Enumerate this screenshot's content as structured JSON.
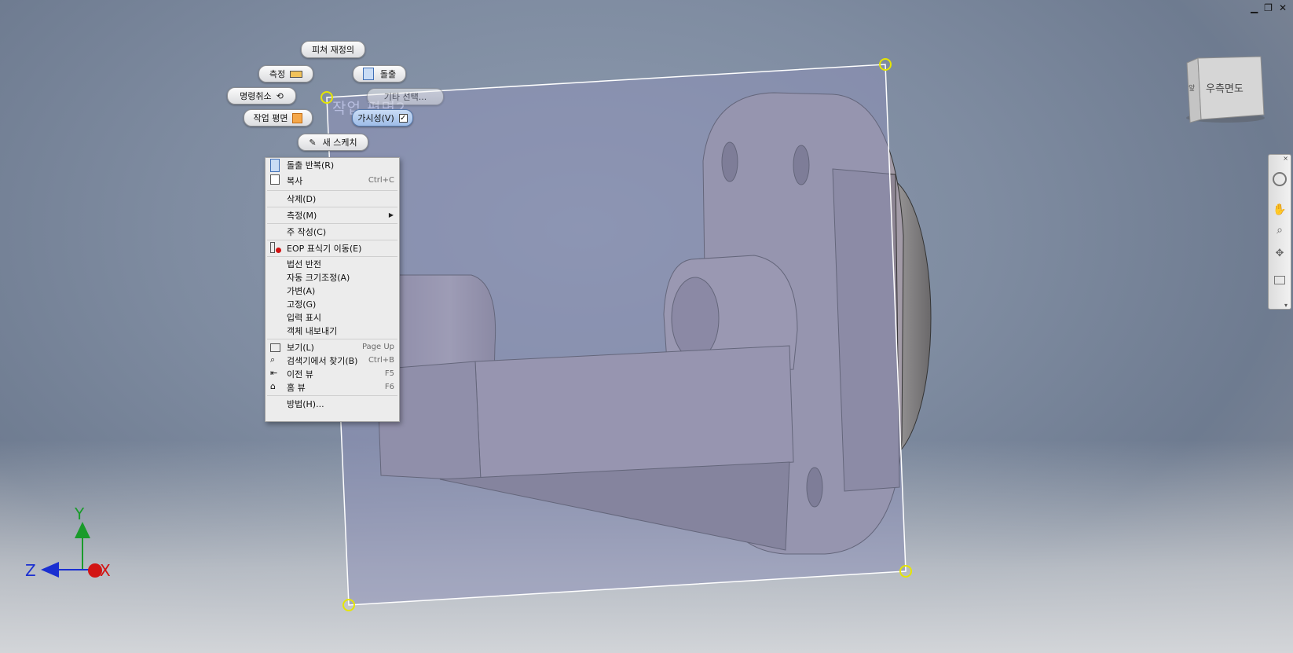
{
  "window_controls": {
    "minimize": "▁",
    "restore": "❐",
    "close": "✕"
  },
  "marking_menu": {
    "feature_redefine": "피쳐 재정의",
    "measure": "측정",
    "extrude": "돌출",
    "undo": "명령취소",
    "select_other": "기타 선택...",
    "work_plane": "작업 평면",
    "visibility": "가시성(V)",
    "new_sketch": "새 스케치"
  },
  "work_plane_label": "작업 평면2",
  "context_menu": {
    "items": [
      {
        "label": "돌출 반복(R)",
        "shortcut": "",
        "icon": "extrude-icon"
      },
      {
        "label": "복사",
        "shortcut": "Ctrl+C",
        "icon": "copy-icon"
      },
      {
        "label": "삭제(D)",
        "shortcut": ""
      },
      {
        "label": "측정(M)",
        "shortcut": "",
        "submenu": true
      },
      {
        "label": "주 작성(C)",
        "shortcut": ""
      },
      {
        "label": "EOP 표식기 이동(E)",
        "shortcut": "",
        "icon": "eop-marker-icon"
      },
      {
        "label": "법선 반전",
        "shortcut": ""
      },
      {
        "label": "자동 크기조정(A)",
        "shortcut": ""
      },
      {
        "label": "가변(A)",
        "shortcut": ""
      },
      {
        "label": "고정(G)",
        "shortcut": ""
      },
      {
        "label": "입력 표시",
        "shortcut": ""
      },
      {
        "label": "객체 내보내기",
        "shortcut": ""
      },
      {
        "label": "보기(L)",
        "shortcut": "Page Up",
        "icon": "view-icon"
      },
      {
        "label": "검색기에서 찾기(B)",
        "shortcut": "Ctrl+B",
        "icon": "find-browser-icon"
      },
      {
        "label": "이전 뷰",
        "shortcut": "F5",
        "icon": "previous-view-icon"
      },
      {
        "label": "홈 뷰",
        "shortcut": "F6",
        "icon": "home-view-icon"
      },
      {
        "label": "방법(H)...",
        "shortcut": ""
      }
    ]
  },
  "viewcube": {
    "face_label": "우측면도",
    "side_label": "앞"
  },
  "triad": {
    "x": "X",
    "y": "Y",
    "z": "Z"
  },
  "colors": {
    "axis_x": "#d21414",
    "axis_y": "#1a9b2b",
    "axis_z": "#1a2fd1",
    "plane_fill": "#8d8fb6",
    "grip": "#e6e600"
  }
}
